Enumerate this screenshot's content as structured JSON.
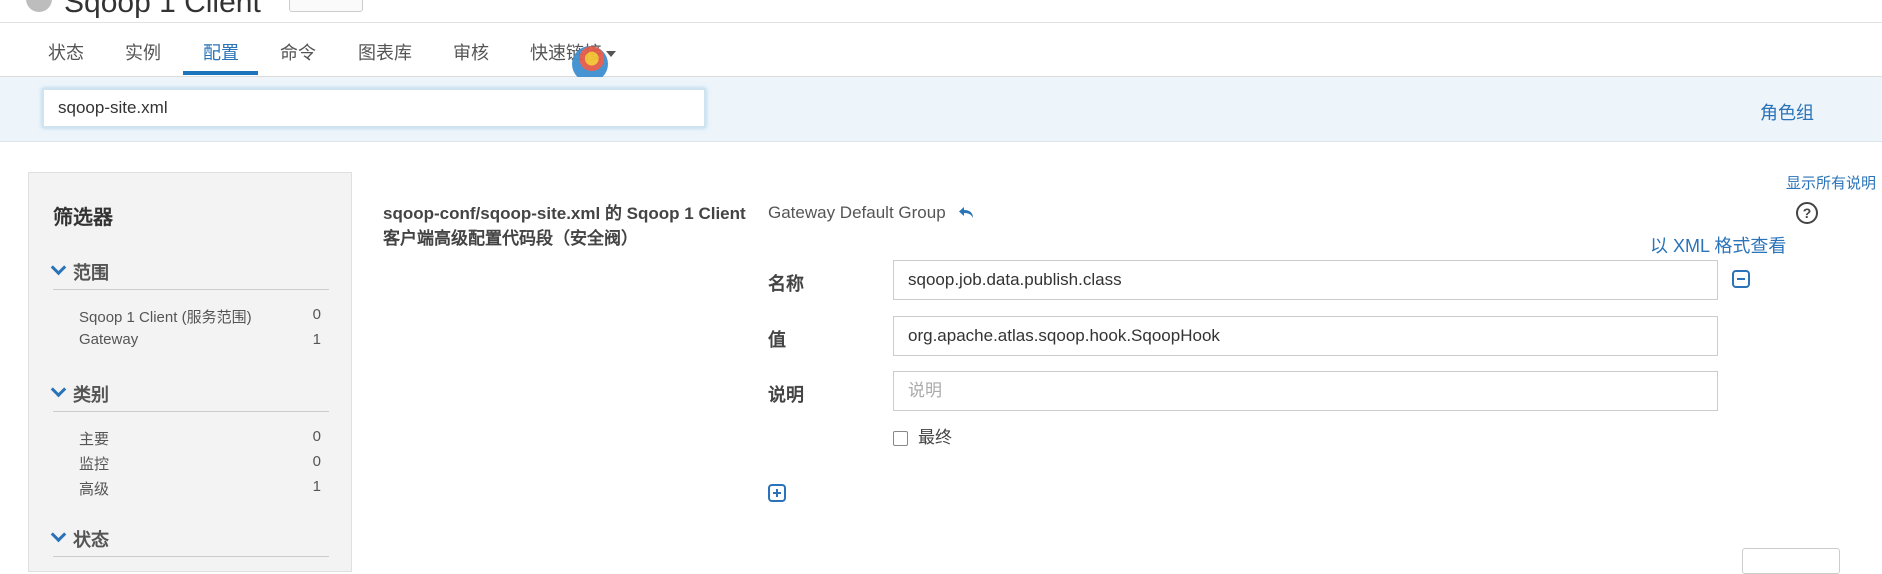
{
  "title": {
    "text": "Sqoop 1 Client"
  },
  "tabs": [
    {
      "label": "状态"
    },
    {
      "label": "实例"
    },
    {
      "label": "配置"
    },
    {
      "label": "命令"
    },
    {
      "label": "图表库"
    },
    {
      "label": "审核"
    },
    {
      "label": "快速链接"
    }
  ],
  "search": {
    "value": "sqoop-site.xml"
  },
  "role_groups_link": "角色组",
  "filters": {
    "heading": "筛选器",
    "groups": [
      {
        "title": "范围",
        "items": [
          {
            "label": "Sqoop 1 Client (服务范围)",
            "count": "0"
          },
          {
            "label": "Gateway",
            "count": "1"
          }
        ]
      },
      {
        "title": "类别",
        "items": [
          {
            "label": "主要",
            "count": "0"
          },
          {
            "label": "监控",
            "count": "0"
          },
          {
            "label": "高级",
            "count": "1"
          }
        ]
      },
      {
        "title": "状态",
        "items": []
      }
    ]
  },
  "property": {
    "description_line1": "sqoop-conf/sqoop-site.xml 的 Sqoop 1 Client",
    "description_line2": "客户端高级配置代码段（安全阀）",
    "group_name": "Gateway Default Group",
    "show_all_descriptions": "显示所有说明",
    "view_as_xml": "以 XML 格式查看",
    "name_label": "名称",
    "name_value": "sqoop.job.data.publish.class",
    "value_label": "值",
    "value_value": "org.apache.atlas.sqoop.hook.SqoopHook",
    "desc_label": "说明",
    "desc_placeholder": "说明",
    "final_label": "最终",
    "help_glyph": "?"
  },
  "colors": {
    "accent": "#2a73b8",
    "tab_underline": "#1c75bc",
    "band": "#eef5fa"
  }
}
